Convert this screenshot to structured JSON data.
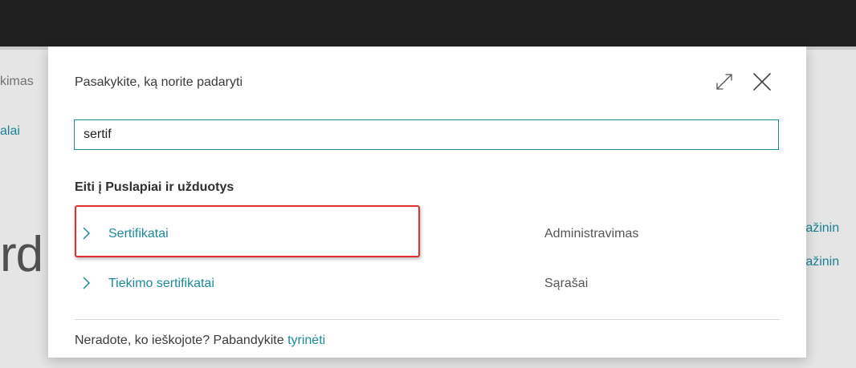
{
  "background": {
    "left_text_1": "kimas",
    "left_text_2": "alai",
    "big_text": "rd",
    "right_text_1": "ražinin",
    "right_text_2": "ražinin"
  },
  "dialog": {
    "title": "Pasakykite, ką norite padaryti",
    "search": {
      "value": "sertif",
      "placeholder": ""
    },
    "section_heading": "Eiti į Puslapiai ir užduotys",
    "results": [
      {
        "label": "Sertifikatai",
        "category": "Administravimas"
      },
      {
        "label": "Tiekimo sertifikatai",
        "category": "Sąrašai"
      }
    ],
    "footer_text": "Neradote, ko ieškojote? Pabandykite ",
    "footer_link": "tyrinėti",
    "icons": {
      "expand": "expand-icon",
      "close": "close-icon",
      "chevron": "chevron-right-icon"
    }
  },
  "colors": {
    "accent": "#1c8a9c",
    "highlight": "#e0302b",
    "topbar": "#232323"
  }
}
